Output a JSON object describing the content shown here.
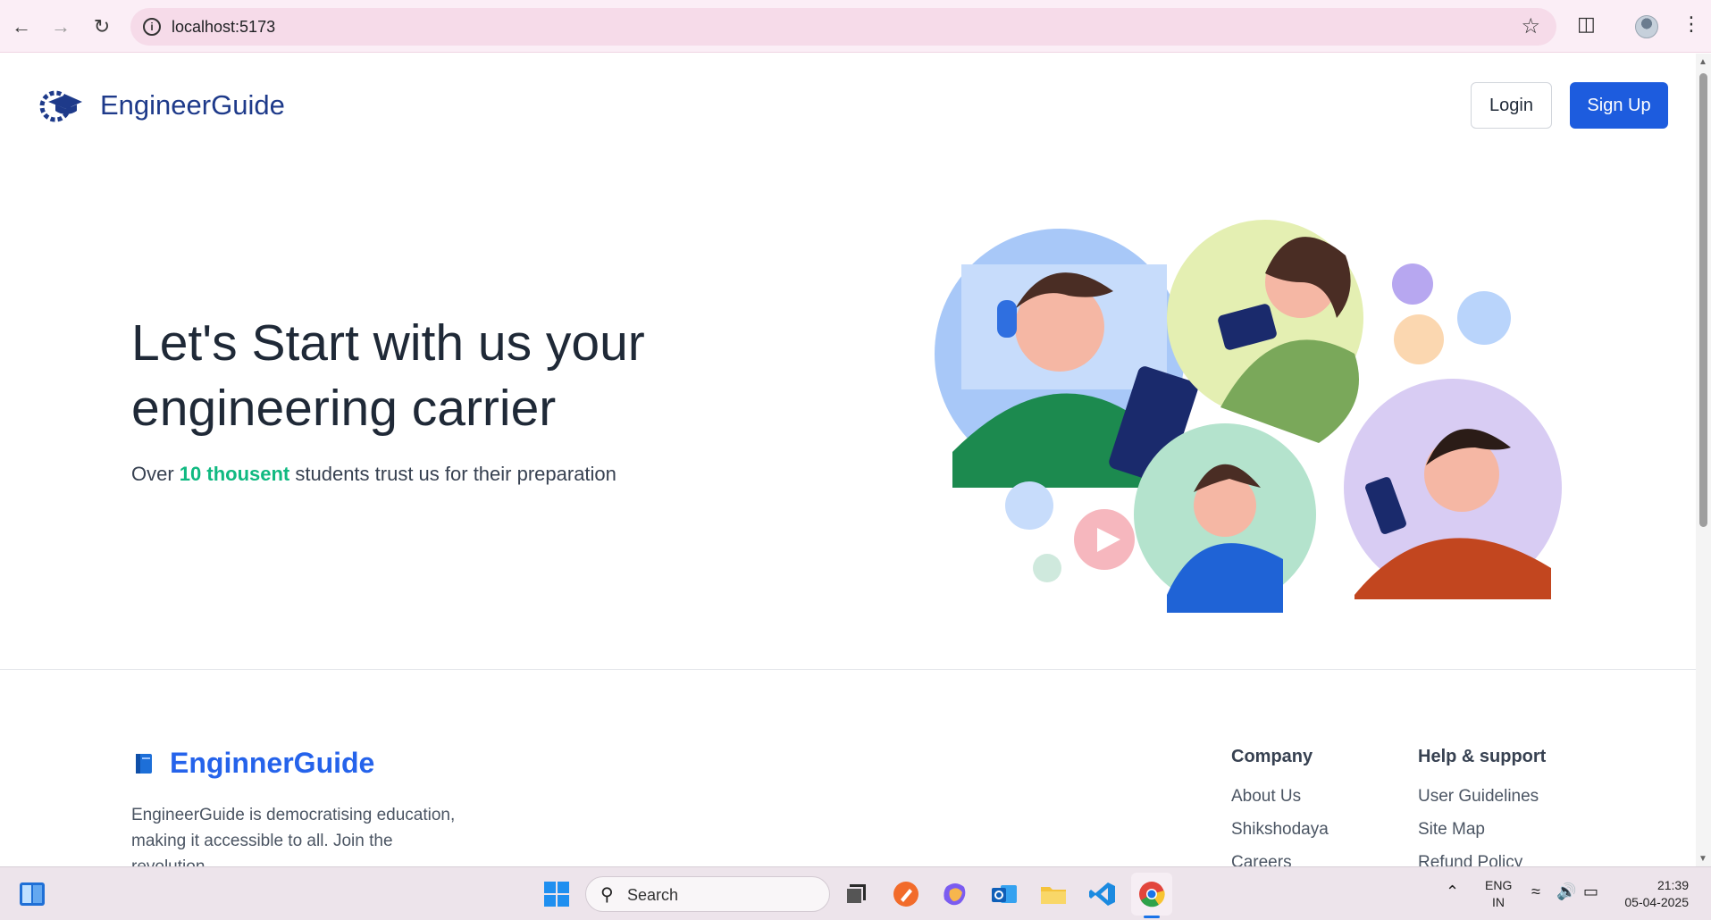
{
  "browser": {
    "url": "localhost:5173"
  },
  "header": {
    "brand": "EngineerGuide",
    "login_label": "Login",
    "signup_label": "Sign Up"
  },
  "hero": {
    "title_line1": "Let's Start with us your",
    "title_line2": "engineering carrier",
    "sub_prefix": "Over ",
    "sub_highlight": "10 thousent",
    "sub_suffix": " students trust us for their preparation"
  },
  "footer": {
    "brand": "EnginnerGuide",
    "description": "EngineerGuide is democratising education, making it accessible to all. Join the revolution",
    "columns": [
      {
        "title": "Company",
        "links": [
          "About Us",
          "Shikshodaya",
          "Careers"
        ]
      },
      {
        "title": "Help & support",
        "links": [
          "User Guidelines",
          "Site Map",
          "Refund Policy"
        ]
      }
    ]
  },
  "taskbar": {
    "search_placeholder": "Search",
    "lang_line1": "ENG",
    "lang_line2": "IN",
    "time": "21:39",
    "date": "05-04-2025"
  },
  "colors": {
    "primary": "#1d5cde",
    "brand_dark": "#1e3a8a",
    "highlight": "#10b981"
  }
}
